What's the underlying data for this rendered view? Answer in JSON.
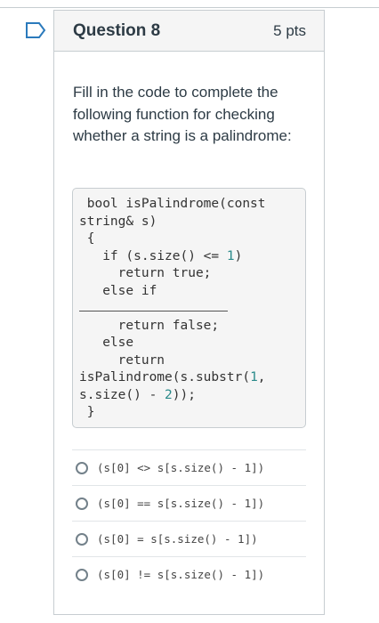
{
  "question": {
    "title": "Question 8",
    "points": "5 pts",
    "prompt": "Fill in the code to complete the following function for checking whether a string is a palindrome:"
  },
  "code": {
    "line1": " bool isPalindrome(const",
    "line2": "string& s)",
    "line3": " {",
    "line4a": "   if (s.size() <= ",
    "line4num": "1",
    "line4b": ")",
    "line5": "     return true;",
    "line6": "   else if",
    "line8": "     return false;",
    "line9": "   else",
    "line10": "     return",
    "line11a": "isPalindrome(s.substr(",
    "line11num": "1",
    "line11b": ",",
    "line12a": "s.size() - ",
    "line12num": "2",
    "line12b": "));",
    "line13": " }"
  },
  "options": [
    {
      "label": "(s[0] <> s[s.size() - 1])",
      "selected": false
    },
    {
      "label": "(s[0] == s[s.size() - 1])",
      "selected": false
    },
    {
      "label": "(s[0] = s[s.size() - 1])",
      "selected": false
    },
    {
      "label": "(s[0] != s[s.size() - 1])",
      "selected": false
    }
  ]
}
